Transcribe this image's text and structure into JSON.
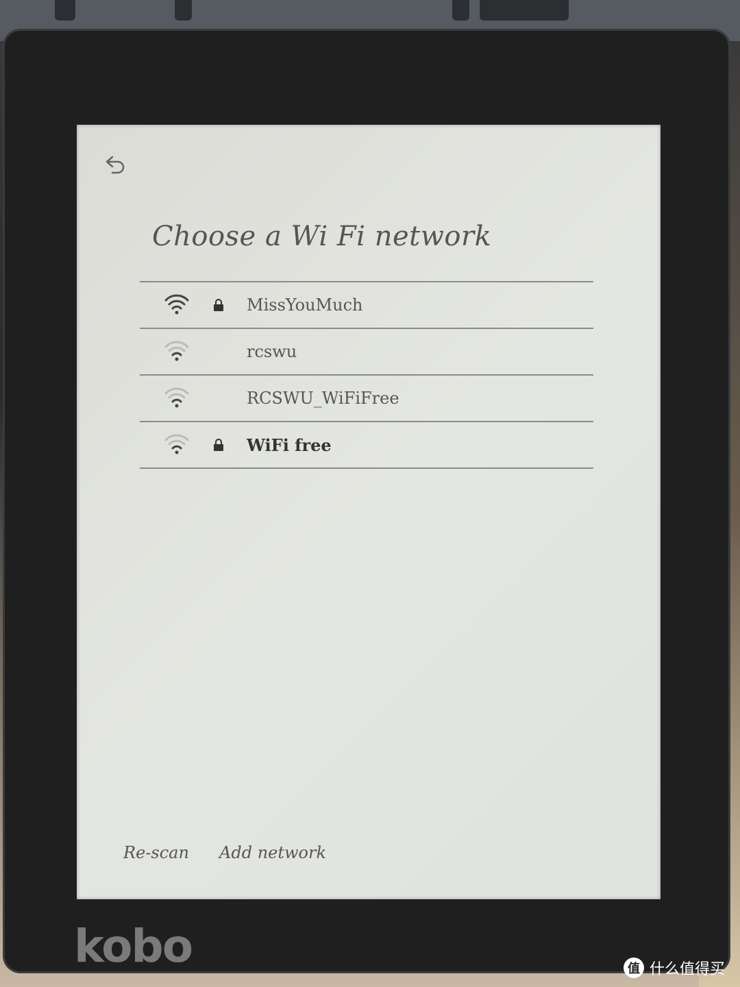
{
  "screen": {
    "title": "Choose a Wi Fi network",
    "back_icon": "back-arrow-icon",
    "networks": [
      {
        "name": "MissYouMuch",
        "secured": true,
        "signal": 1.0,
        "selected": false
      },
      {
        "name": "rcswu",
        "secured": false,
        "signal": 0.5,
        "selected": false
      },
      {
        "name": "RCSWU_WiFiFree",
        "secured": false,
        "signal": 0.5,
        "selected": false
      },
      {
        "name": "WiFi free",
        "secured": true,
        "signal": 0.5,
        "selected": true
      }
    ],
    "footer": {
      "rescan": "Re-scan",
      "add_network": "Add network"
    }
  },
  "device": {
    "brand_logo": "kobo"
  },
  "watermark": {
    "badge": "值",
    "text": "什么值得买"
  },
  "colors": {
    "screen": "#e2e4df",
    "bezel": "#1f1f1f",
    "text": "#555555"
  }
}
